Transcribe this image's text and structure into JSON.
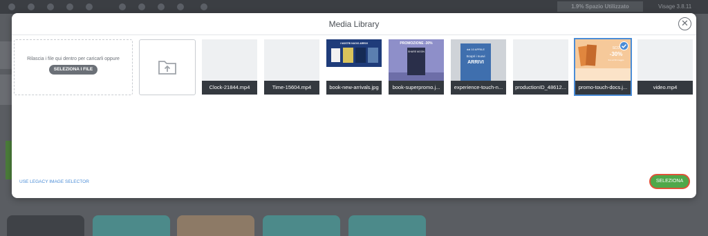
{
  "background": {
    "usage": "1.9% Spazio Utilizzato",
    "user": "Visage 3.8.11"
  },
  "modal": {
    "title": "Media Library",
    "close_glyph": "✕",
    "dropzone": {
      "text": "Rilascia i file qui dentro per caricarli oppure",
      "button_label": "SELEZIONA I FILE"
    },
    "folder_icon": "folder-upload-icon",
    "items": [
      {
        "label": "Clock-21844.mp4",
        "kind": "video",
        "selected": false
      },
      {
        "label": "Time-15604.mp4",
        "kind": "video",
        "selected": false
      },
      {
        "label": "book-new-arrivals.jpg",
        "kind": "image",
        "selected": false
      },
      {
        "label": "book-superpromo.j...",
        "kind": "image",
        "selected": false
      },
      {
        "label": "experience-touch-n...",
        "kind": "image",
        "selected": false
      },
      {
        "label": "productionID_48612...",
        "kind": "video",
        "selected": false
      },
      {
        "label": "promo-touch-docs.j...",
        "kind": "image",
        "selected": true
      },
      {
        "label": "video.mp4",
        "kind": "video",
        "selected": false
      }
    ],
    "thumb_text": {
      "new_arrivals_header": "I NOSTRI NUOVI ARRIVI",
      "promo_header": "PROMOZIONE -30%",
      "promo_book": "SHARE MOON",
      "experience_line1": "dal 10 APRILE",
      "experience_line2": "Scopri i nuovi",
      "experience_line3": "ARRIVI",
      "touch_promo_line1": "SCO",
      "touch_promo_line2": "-30%",
      "touch_promo_line3": "fino al 30 maggio"
    },
    "legacy_link": "USE LEGACY IMAGE SELECTOR",
    "select_button": "SELEZIONA"
  },
  "colors": {
    "accent_blue": "#4a8cd6",
    "select_green": "#4fa84a",
    "select_border_red": "#e05238",
    "label_bar": "#34393f",
    "overlay": "#5a5d62"
  }
}
